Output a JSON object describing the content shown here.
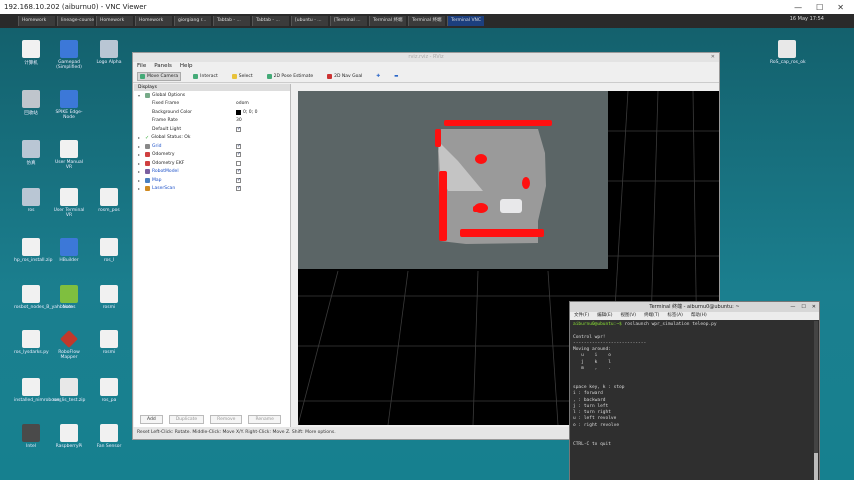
{
  "vnc": {
    "title": "192.168.10.202 (aiburnu0) - VNC Viewer"
  },
  "taskbar": {
    "items": [
      "Homework",
      "lineage-course",
      "Homework",
      "Homework",
      "giorgiang r...",
      "Tabtab - ...",
      "Tabtab - ...",
      "[ubuntu - ...",
      "[Terminal ...",
      "Terminal 终端",
      "Terminal 终端",
      "Terminal VNC"
    ],
    "clock": "16 May 17:54"
  },
  "desktop_icons": [
    {
      "label": "计算机",
      "glyph": "white"
    },
    {
      "label": "Gamepad (Simplified)",
      "glyph": "blue"
    },
    {
      "label": "Logo Alpha",
      "glyph": "folder"
    },
    {
      "label": "回收站",
      "glyph": "gray"
    },
    {
      "label": "SPIKE Edge-Node",
      "glyph": "blue"
    },
    {
      "label": "仿真",
      "glyph": "folder"
    },
    {
      "label": "User Manual VR",
      "glyph": "white"
    },
    {
      "label": "ros",
      "glyph": "folder"
    },
    {
      "label": "User Terminal VR",
      "glyph": "white"
    },
    {
      "label": "rosm_pos",
      "glyph": "white"
    },
    {
      "label": "hp_ros_install.zip",
      "glyph": "white"
    },
    {
      "label": "HBuilder",
      "glyph": "blue"
    },
    {
      "label": "ros_l",
      "glyph": "white"
    },
    {
      "label": "rosbot_nodes_B_yahboom",
      "glyph": "white"
    },
    {
      "label": "Notes",
      "glyph": "green"
    },
    {
      "label": "rosmi",
      "glyph": "white"
    },
    {
      "label": "ros_lysdarks.py",
      "glyph": "white"
    },
    {
      "label": "RoboFlow Mapper",
      "glyph": "red"
    },
    {
      "label": "rosmi",
      "glyph": "white"
    },
    {
      "label": "installed_nimroboxes",
      "glyph": "white"
    },
    {
      "label": "ros_lis_test.zip",
      "glyph": "gear"
    },
    {
      "label": "ros_pa",
      "glyph": "white"
    },
    {
      "label": "Intel",
      "glyph": "dark"
    },
    {
      "label": "RaspberryPi",
      "glyph": "white"
    },
    {
      "label": "Fan Sensor",
      "glyph": "white"
    },
    {
      "label": "RoS_cap_ros_ok",
      "glyph": "gear"
    }
  ],
  "rviz": {
    "title": "rviz.rviz - RViz",
    "menu": [
      "File",
      "Panels",
      "Help"
    ],
    "tools": [
      "Move Camera",
      "Interact",
      "Select",
      "2D Pose Estimate",
      "2D Nav Goal"
    ],
    "displays_header": "Displays",
    "global_options_label": "Global Options",
    "fixed_frame_label": "Fixed Frame",
    "fixed_frame_value": "odom",
    "bg_label": "Background Color",
    "bg_value": "0; 0; 0",
    "frame_rate_label": "Frame Rate",
    "frame_rate_value": "30",
    "default_light_label": "Default Light",
    "global_status_label": "Global Status: Ok",
    "displays": [
      {
        "name": "Grid",
        "checked": true,
        "blue": true,
        "color": "#888888"
      },
      {
        "name": "Odometry",
        "checked": true,
        "blue": false,
        "color": "#d04040"
      },
      {
        "name": "Odometry EKF",
        "checked": false,
        "blue": false,
        "color": "#d04040"
      },
      {
        "name": "RobotModel",
        "checked": true,
        "blue": true,
        "color": "#7a5fa0"
      },
      {
        "name": "Map",
        "checked": true,
        "blue": true,
        "color": "#4a7fbf"
      },
      {
        "name": "LaserScan",
        "checked": true,
        "blue": true,
        "color": "#d08a20"
      }
    ],
    "buttons": [
      "Add",
      "Duplicate",
      "Remove",
      "Rename"
    ],
    "status": "Reset   Left-Click: Rotate. Middle-Click: Move X/Y. Right-Click: Move Z. Shift: More options."
  },
  "terminal": {
    "title": "Terminal 终端 - aiburnu0@ubuntu: ~",
    "menu": [
      "文件(F)",
      "编辑(E)",
      "视图(V)",
      "终端(T)",
      "标签(A)",
      "帮助(H)"
    ],
    "prompt": "aiburnu0@ubuntu:~$",
    "command": " roslaunch wpr_simulation teleop.py",
    "lines": [
      "",
      "Control wpr!",
      "---------------------------",
      "Moving around:",
      "   u    i    o",
      "   j    k    l",
      "   m    ,    .",
      "",
      "",
      "space key, k : stop",
      "i : forward",
      ", : backward",
      "j : turn left",
      "l : turn right",
      "u : left revolve",
      "o : right revolve",
      "",
      "",
      "CTRL-C to quit"
    ]
  }
}
